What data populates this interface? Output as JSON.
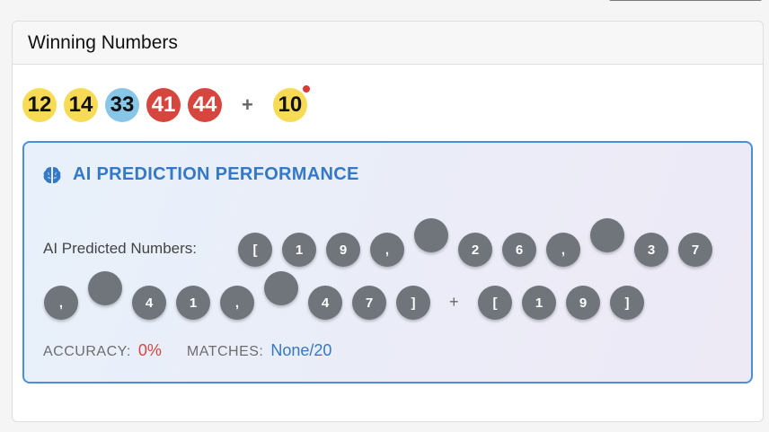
{
  "card": {
    "title": "Winning Numbers"
  },
  "winning": {
    "numbers": [
      {
        "value": "12",
        "color": "#f8db55"
      },
      {
        "value": "14",
        "color": "#f8db55"
      },
      {
        "value": "33",
        "color": "#88c6e8"
      },
      {
        "value": "41",
        "color": "#d6463e"
      },
      {
        "value": "44",
        "color": "#d6463e"
      }
    ],
    "separator": "+",
    "bonus": {
      "value": "10",
      "color": "#f8db55",
      "indicator_color": "#d9383a"
    }
  },
  "ai": {
    "icon": "brain-icon",
    "title": "AI PREDICTION PERFORMANCE",
    "predicted_label": "AI Predicted Numbers:",
    "predicted_row1": [
      "[",
      "1",
      "9",
      ",",
      "",
      "2",
      "6",
      ",",
      "",
      "3",
      "7"
    ],
    "predicted_row2": [
      ",",
      "",
      "4",
      "1",
      ",",
      "",
      "4",
      "7",
      "]"
    ],
    "predicted_separator": "+",
    "predicted_bonus": [
      "[",
      "1",
      "9",
      "]"
    ],
    "accuracy_label": "ACCURACY:",
    "accuracy_value": "0%",
    "matches_label": "MATCHES:",
    "matches_value": "None/20",
    "accent_color": "#3478c8"
  }
}
